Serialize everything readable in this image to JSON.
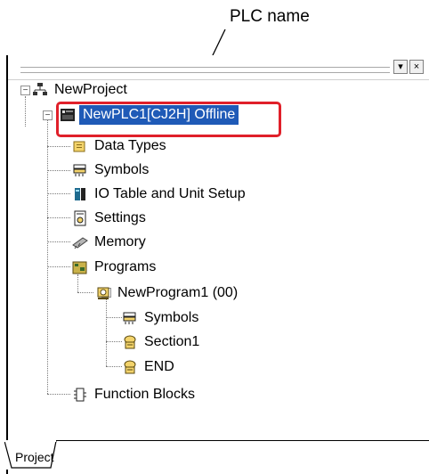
{
  "callout": {
    "label": "PLC name"
  },
  "pane": {
    "header_buttons": [
      "▾",
      "×"
    ]
  },
  "tree": {
    "root": {
      "label": "NewProject",
      "icon": "network-icon"
    },
    "plc": {
      "label": "NewPLC1[CJ2H] Offline",
      "icon": "plc-icon",
      "selected": true
    },
    "items": [
      {
        "label": "Data Types",
        "icon": "data-types-icon"
      },
      {
        "label": "Symbols",
        "icon": "symbols-icon"
      },
      {
        "label": "IO Table and Unit Setup",
        "icon": "io-table-icon"
      },
      {
        "label": "Settings",
        "icon": "settings-icon"
      },
      {
        "label": "Memory",
        "icon": "memory-icon"
      },
      {
        "label": "Programs",
        "icon": "programs-icon"
      }
    ],
    "program": {
      "label": "NewProgram1 (00)",
      "icon": "program-icon"
    },
    "program_items": [
      {
        "label": "Symbols",
        "icon": "symbols-icon"
      },
      {
        "label": "Section1",
        "icon": "section-icon"
      },
      {
        "label": "END",
        "icon": "section-icon"
      }
    ],
    "function_blocks": {
      "label": "Function Blocks",
      "icon": "function-blocks-icon"
    }
  },
  "tabs": [
    {
      "label": "Project",
      "active": true
    }
  ],
  "colors": {
    "selection": "#1f5ab7",
    "highlight": "#e0202a"
  }
}
